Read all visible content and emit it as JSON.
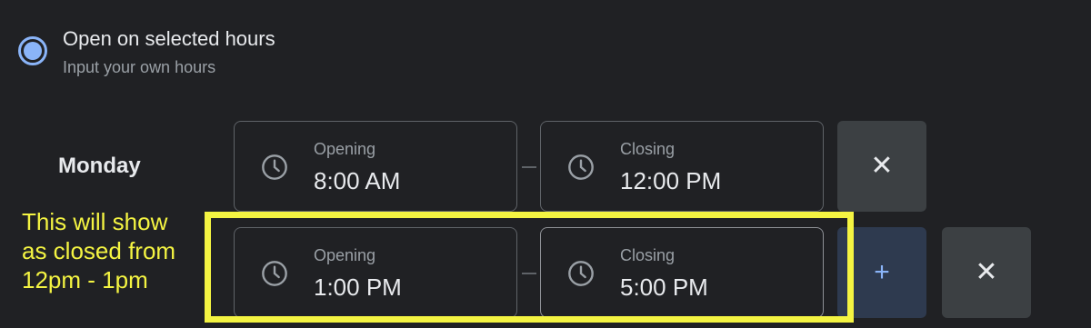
{
  "option": {
    "title": "Open on selected hours",
    "subtitle": "Input your own hours",
    "selected": true
  },
  "day": {
    "label": "Monday"
  },
  "rows": [
    {
      "opening": {
        "label": "Opening",
        "value": "8:00 AM"
      },
      "closing": {
        "label": "Closing",
        "value": "12:00 PM"
      },
      "remove_label": "✕"
    },
    {
      "opening": {
        "label": "Opening",
        "value": "1:00 PM"
      },
      "closing": {
        "label": "Closing",
        "value": "5:00 PM"
      },
      "add_label": "+",
      "remove_label": "✕"
    }
  ],
  "annotation": {
    "lines": [
      "This will show",
      "as closed from",
      "12pm - 1pm"
    ],
    "color": "#f4f442"
  },
  "colors": {
    "accent": "#8ab4f8",
    "background": "#202124",
    "button": "#3c4043",
    "add_button": "#2e3a4f"
  },
  "icons": {
    "radio": "radio-selected-icon",
    "clock": "clock-icon",
    "add": "plus-icon",
    "remove": "close-icon"
  }
}
